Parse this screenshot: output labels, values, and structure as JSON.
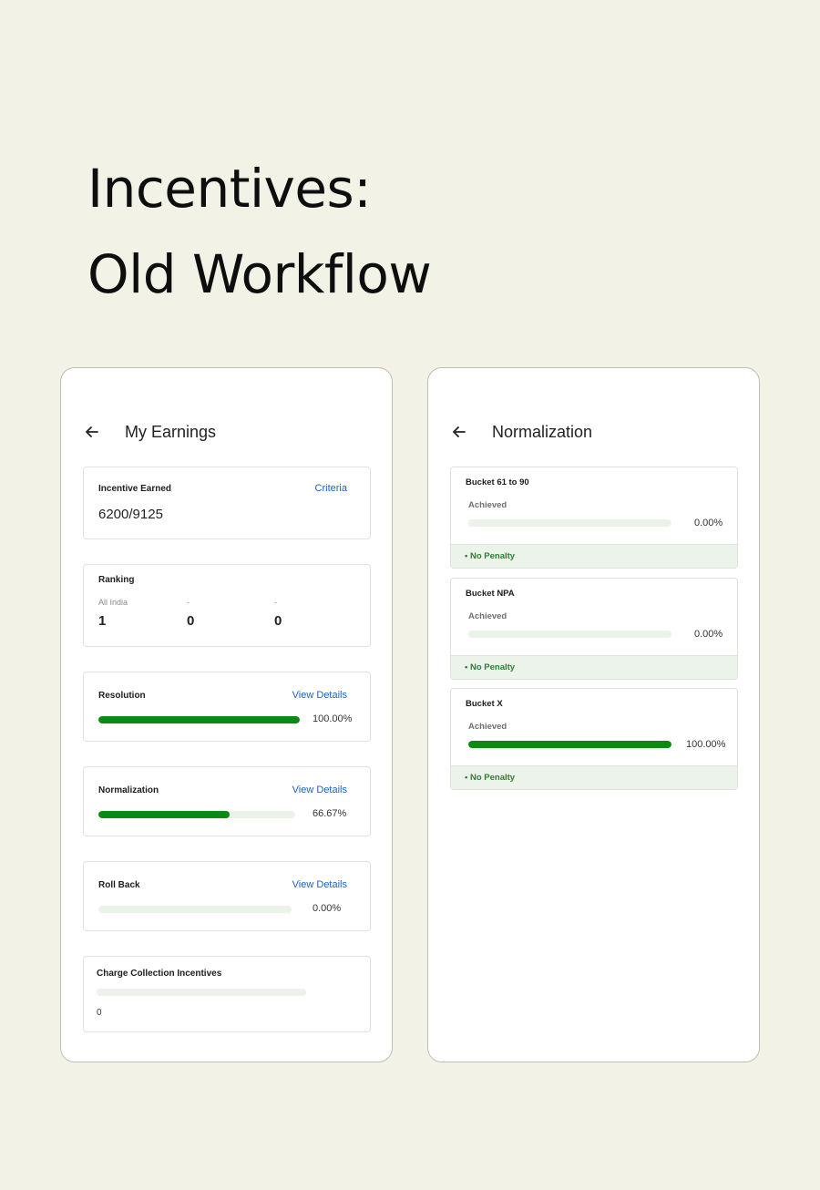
{
  "headline": {
    "line1": "Incentives:",
    "line2": "Old Workflow"
  },
  "colors": {
    "background": "#f2f3e6",
    "link": "#1f5fbf",
    "progress_fill": "#0b8a12",
    "progress_track": "#ebf2ea",
    "penalty_text": "#2d7d33",
    "penalty_bg": "#ebf3ea"
  },
  "left_screen": {
    "title": "My Earnings",
    "back_icon": "arrow-left-icon",
    "incentive": {
      "label": "Incentive Earned",
      "link": "Criteria",
      "value": "6200/9125"
    },
    "ranking": {
      "label": "Ranking",
      "columns": [
        {
          "label": "All India",
          "value": "1"
        },
        {
          "label": "-",
          "value": "0"
        },
        {
          "label": "-",
          "value": "0"
        }
      ]
    },
    "resolution": {
      "label": "Resolution",
      "link": "View Details",
      "percent_text": "100.00%",
      "progress": 1.0
    },
    "normalization": {
      "label": "Normalization",
      "link": "View Details",
      "percent_text": "66.67%",
      "progress": 0.6667
    },
    "rollback": {
      "label": "Roll Back",
      "link": "View Details",
      "percent_text": "0.00%",
      "progress": 0.0
    },
    "charge": {
      "label": "Charge Collection Incentives",
      "value": "0",
      "progress": 0.0
    }
  },
  "right_screen": {
    "title": "Normalization",
    "back_icon": "arrow-left-icon",
    "buckets": [
      {
        "name": "Bucket 61 to 90",
        "achieved_label": "Achieved",
        "percent_text": "0.00%",
        "progress": 0.0,
        "penalty": "• No Penalty"
      },
      {
        "name": "Bucket NPA",
        "achieved_label": "Achieved",
        "percent_text": "0.00%",
        "progress": 0.0,
        "penalty": "• No Penalty"
      },
      {
        "name": "Bucket X",
        "achieved_label": "Achieved",
        "percent_text": "100.00%",
        "progress": 1.0,
        "penalty": "• No Penalty"
      }
    ]
  }
}
